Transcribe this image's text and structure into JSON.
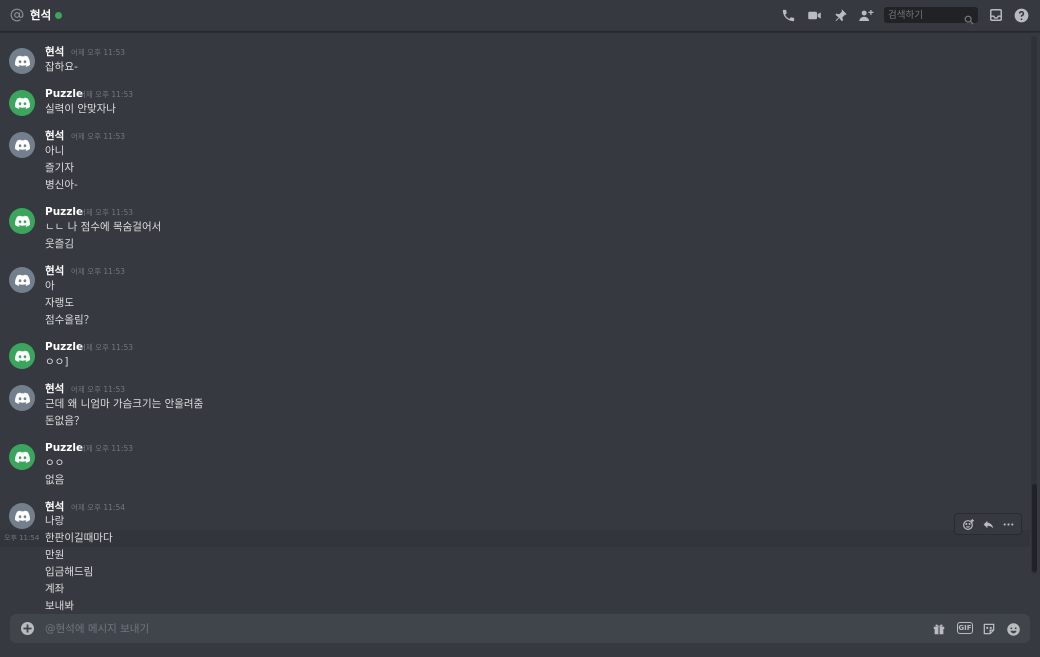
{
  "header": {
    "title": "현석",
    "status_color": "#3ba55d",
    "icons": [
      "at-icon",
      "voice-call-icon",
      "video-call-icon",
      "pin-icon",
      "add-friend-icon",
      "inbox-icon",
      "help-icon"
    ],
    "search_placeholder": "검색하기"
  },
  "messages": [
    {
      "author": "현석",
      "avatar": "gray",
      "timestamp": "어제 오후 11:53",
      "lines": [
        "잡하요-"
      ]
    },
    {
      "author": "Puzzle",
      "avatar": "green",
      "timestamp": "어제 오후 11:53",
      "lines": [
        "실력이 안맞자나"
      ]
    },
    {
      "author": "현석",
      "avatar": "gray",
      "timestamp": "어제 오후 11:53",
      "lines": [
        "아니",
        "즐기자",
        "병신아-"
      ]
    },
    {
      "author": "Puzzle",
      "avatar": "green",
      "timestamp": "어제 오후 11:53",
      "lines": [
        "ㄴㄴ 나 점수에 목숨걸어서",
        "웃즐김"
      ]
    },
    {
      "author": "현석",
      "avatar": "gray",
      "timestamp": "어제 오후 11:53",
      "lines": [
        "아",
        "자랭도",
        "점수올림？"
      ]
    },
    {
      "author": "Puzzle",
      "avatar": "green",
      "timestamp": "어제 오후 11:53",
      "lines": [
        "ㅇㅇ]"
      ]
    },
    {
      "author": "현석",
      "avatar": "gray",
      "timestamp": "어제 오후 11:53",
      "lines": [
        "근데 왜 니엄마 가슴크기는 안올려줌",
        "돈없음？"
      ]
    },
    {
      "author": "Puzzle",
      "avatar": "green",
      "timestamp": "어제 오후 11:53",
      "lines": [
        "ㅇㅇ",
        "없음"
      ]
    },
    {
      "author": "현석",
      "avatar": "gray",
      "timestamp": "어제 오후 11:54",
      "lines": [
        "나랑",
        "한판이길때마다",
        "만원",
        "입금해드림",
        "계좌",
        "보내봐"
      ]
    }
  ],
  "hover_timestamp": "오후 11:54",
  "message_toolbar": {
    "icons": [
      "add-reaction-icon",
      "reply-icon",
      "more-icon"
    ]
  },
  "composer": {
    "placeholder": "@현석에 메시지 보내기",
    "gif_label": "GIF",
    "icons": [
      "add-attachment-icon",
      "gift-icon",
      "gif-icon",
      "sticker-icon",
      "emoji-icon"
    ]
  }
}
